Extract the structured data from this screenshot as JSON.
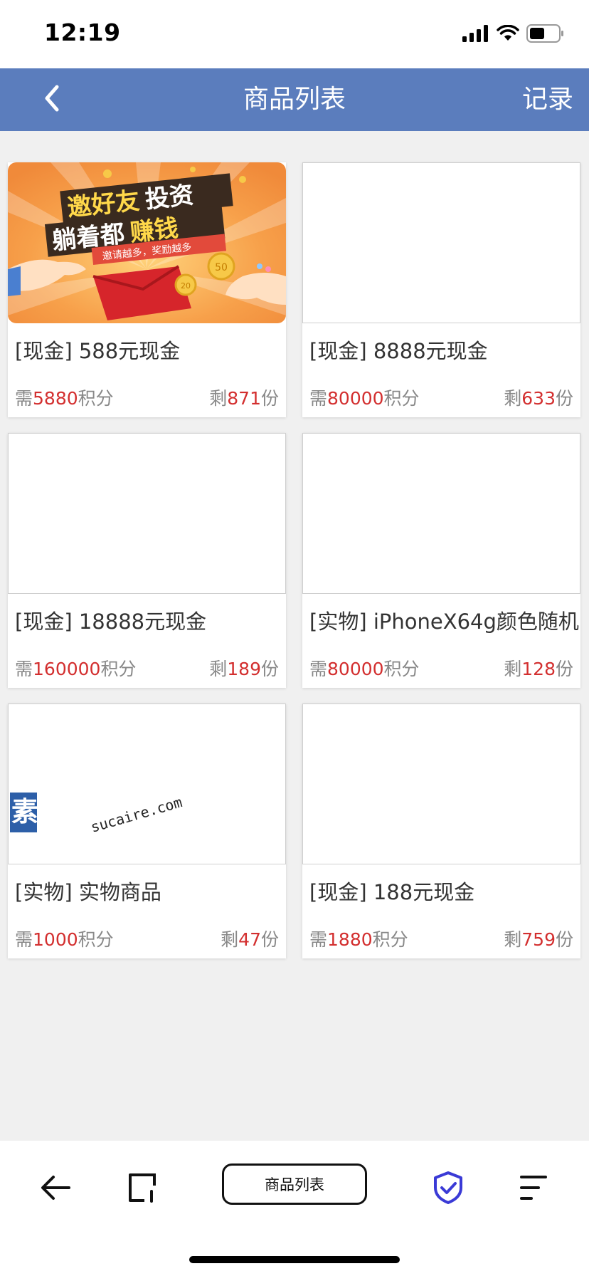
{
  "status_bar": {
    "time": "12:19"
  },
  "header": {
    "title": "商品列表",
    "right_link": "记录"
  },
  "banner": {
    "line1_a": "邀好友",
    "line1_b": "投资",
    "line2_a": "躺着都",
    "line2_b": "赚钱",
    "slogan": "邀请越多，奖励越多",
    "coin1": "50",
    "coin2": "20"
  },
  "watermark": {
    "brand": "素材熱",
    "domain": "sucaire.com"
  },
  "products": [
    {
      "name": "[现金] 588元现金",
      "need_prefix": "需",
      "points": "5880",
      "need_suffix": "积分",
      "left_prefix": "剩",
      "stock": "871",
      "left_suffix": "份",
      "image": "banner"
    },
    {
      "name": "[现金] 8888元现金",
      "need_prefix": "需",
      "points": "80000",
      "need_suffix": "积分",
      "left_prefix": "剩",
      "stock": "633",
      "left_suffix": "份",
      "image": "blank"
    },
    {
      "name": "[现金] 18888元现金",
      "need_prefix": "需",
      "points": "160000",
      "need_suffix": "积分",
      "left_prefix": "剩",
      "stock": "189",
      "left_suffix": "份",
      "image": "blank"
    },
    {
      "name": "[实物] iPhoneX64g颜色随机",
      "need_prefix": "需",
      "points": "80000",
      "need_suffix": "积分",
      "left_prefix": "剩",
      "stock": "128",
      "left_suffix": "份",
      "image": "blank"
    },
    {
      "name": "[实物] 实物商品",
      "need_prefix": "需",
      "points": "1000",
      "need_suffix": "积分",
      "left_prefix": "剩",
      "stock": "47",
      "left_suffix": "份",
      "image": "watermark"
    },
    {
      "name": "[现金] 188元现金",
      "need_prefix": "需",
      "points": "1880",
      "need_suffix": "积分",
      "left_prefix": "剩",
      "stock": "759",
      "left_suffix": "份",
      "image": "blank"
    }
  ],
  "toolbar": {
    "center_label": "商品列表"
  },
  "colors": {
    "header_bg": "#5b7dbd",
    "accent_red": "#d32f2f",
    "shield_blue": "#3a3ad6",
    "page_bg": "#f0f0f0"
  },
  "icons": {
    "back": "chevron-left-icon",
    "toolbar_back": "arrow-left-icon",
    "tabs": "tabs-icon",
    "shield": "shield-check-icon",
    "menu": "menu-lines-icon"
  }
}
